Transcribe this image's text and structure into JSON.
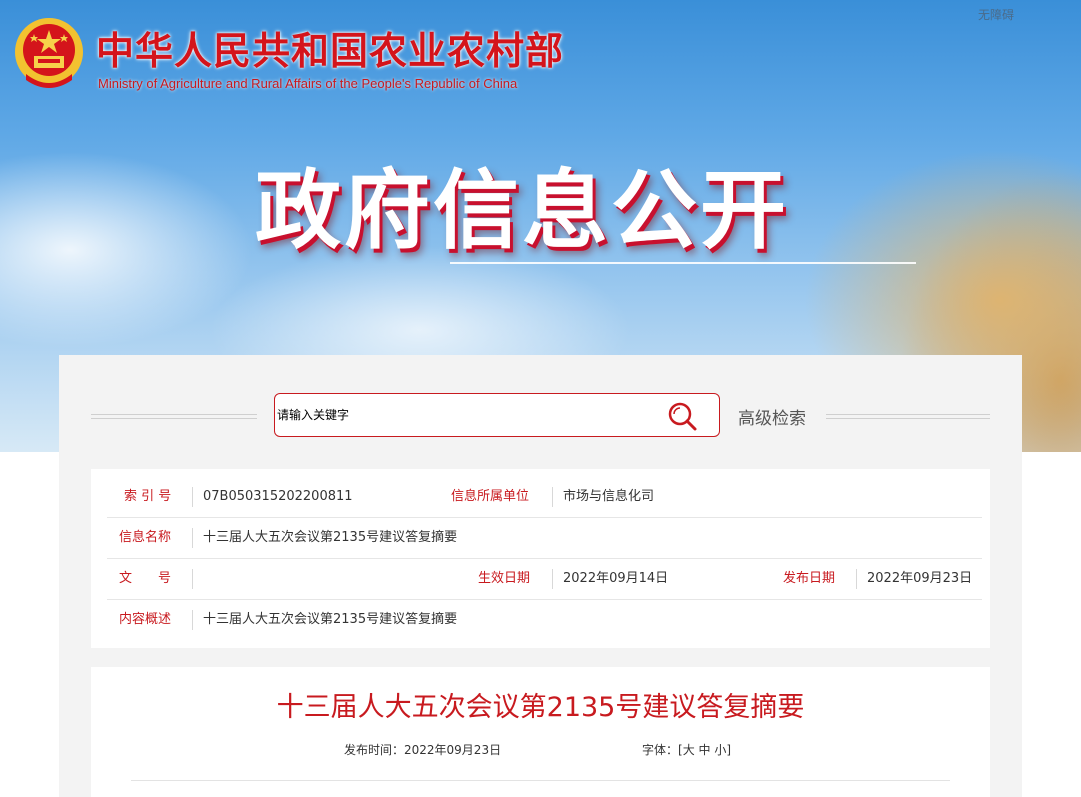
{
  "header": {
    "title": "中华人民共和国农业农村部",
    "subtitle": "Ministry of Agriculture and Rural Affairs of the People's Republic of China",
    "accessibility": "无障碍",
    "hero": "政府信息公开"
  },
  "search": {
    "placeholder": "请输入关键字",
    "advanced": "高级检索"
  },
  "meta": {
    "index_label": "索 引 号",
    "index_value": "07B050315202200811",
    "unit_label": "信息所属单位",
    "unit_value": "市场与信息化司",
    "name_label": "信息名称",
    "name_value": "十三届人大五次会议第2135号建议答复摘要",
    "doc_label": "文　　号",
    "doc_value": "",
    "effective_label": "生效日期",
    "effective_value": "2022年09月14日",
    "publish_label": "发布日期",
    "publish_value": "2022年09月23日",
    "summary_label": "内容概述",
    "summary_value": "十三届人大五次会议第2135号建议答复摘要"
  },
  "article": {
    "title": "十三届人大五次会议第2135号建议答复摘要",
    "date": "发布时间：2022年09月23日",
    "font_label": "字体：[",
    "font_large": "大",
    "font_medium": "中",
    "font_small": "小",
    "font_end": "]"
  },
  "colors": {
    "accent": "#c81a1f",
    "panel_bg": "#f3f3f3"
  }
}
